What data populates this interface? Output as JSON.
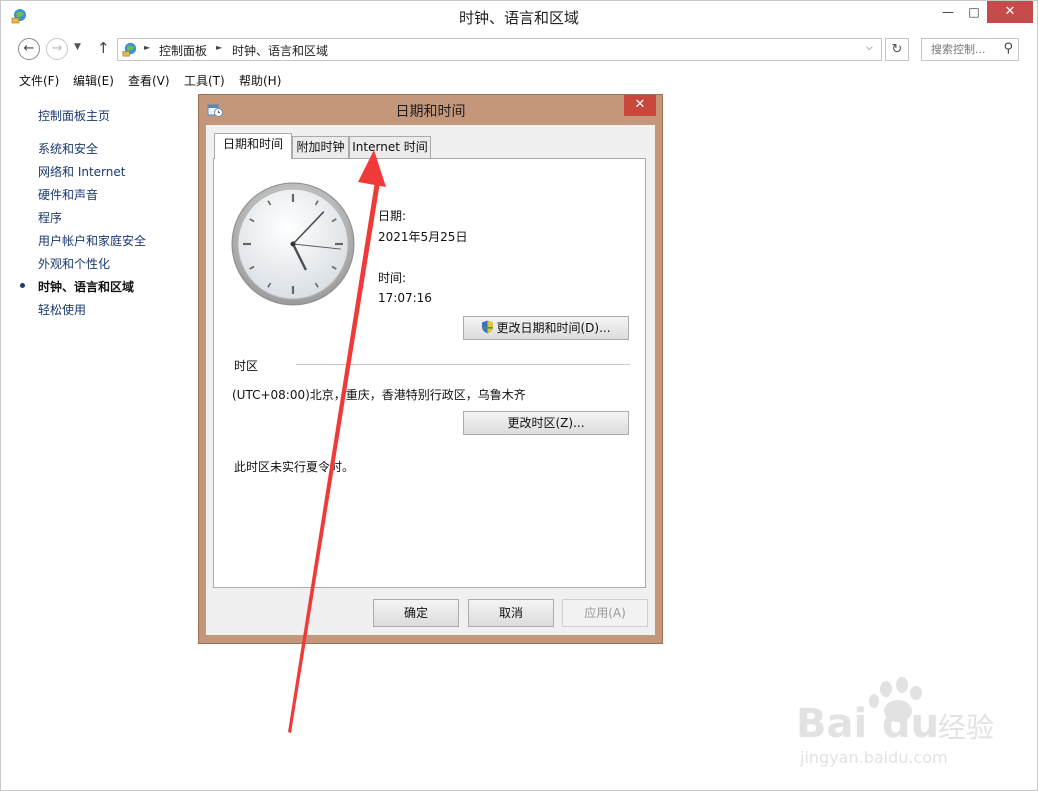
{
  "window": {
    "title": "时钟、语言和区域",
    "min_glyph": "—",
    "max_glyph": "□",
    "close_glyph": "✕"
  },
  "nav": {
    "back": "←",
    "forward": "→",
    "recent": "▼",
    "up": "↑",
    "crumbs": [
      "控制面板",
      "时钟、语言和区域"
    ],
    "sep": "►",
    "dropdown": "⌵",
    "refresh": "↻",
    "search_placeholder": "搜索控制...",
    "search_glyph": "⚲"
  },
  "menu": [
    "文件(F)",
    "编辑(E)",
    "查看(V)",
    "工具(T)",
    "帮助(H)"
  ],
  "sidebar": {
    "home": "控制面板主页",
    "items": [
      "系统和安全",
      "网络和 Internet",
      "硬件和声音",
      "程序",
      "用户帐户和家庭安全",
      "外观和个性化",
      "时钟、语言和区域",
      "轻松使用"
    ],
    "active_index": 6
  },
  "dialog": {
    "title": "日期和时间",
    "close_glyph": "✕",
    "tabs": [
      "日期和时间",
      "附加时钟",
      "Internet 时间"
    ],
    "date_label": "日期:",
    "date_value": "2021年5月25日",
    "time_label": "时间:",
    "time_value": "17:07:16",
    "change_datetime_button": "更改日期和时间(D)...",
    "timezone_heading": "时区",
    "timezone_value": "(UTC+08:00)北京，重庆，香港特别行政区，乌鲁木齐",
    "change_timezone_button": "更改时区(Z)...",
    "dst_note": "此时区未实行夏令时。",
    "ok": "确定",
    "cancel": "取消",
    "apply": "应用(A)"
  },
  "clock": {
    "hour": 17,
    "minute": 7,
    "second": 16
  },
  "watermark": {
    "brand": "Bai",
    "brand_tail": "du",
    "suffix": "经验",
    "url": "jingyan.baidu.com"
  },
  "colors": {
    "accent_red": "#f03a3a",
    "dialog_frame": "#c5977a",
    "close_red": "#c9473d"
  }
}
